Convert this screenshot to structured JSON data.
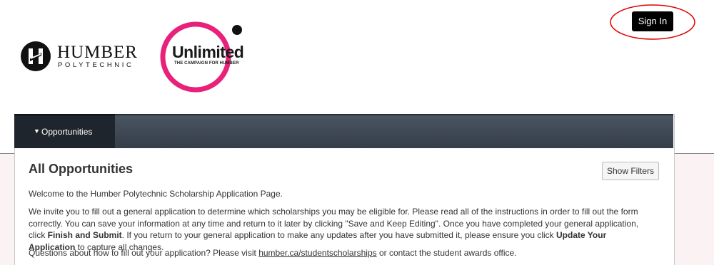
{
  "header": {
    "humber_logo": {
      "name": "HUMBER",
      "subtitle": "POLYTECHNIC"
    },
    "campaign_logo": {
      "name": "Unlimited",
      "subtitle": "THE CAMPAIGN FOR HUMBER",
      "ring_color": "#e8217a"
    },
    "sign_in_label": "Sign In",
    "highlight_color": "#e00000"
  },
  "nav": {
    "active_tab": "Opportunities",
    "caret_icon": "triangle-down-icon"
  },
  "main": {
    "title": "All Opportunities",
    "show_filters_label": "Show Filters",
    "welcome": "Welcome to the Humber Polytechnic Scholarship Application Page.",
    "intro_part1": "We invite you to fill out a general application to determine which scholarships you may be eligible for. Please read all of the instructions in order to fill out the form correctly. You can save your information at any time and return to it later by clicking \"Save and Keep Editing\". Once you have completed your general application, click ",
    "intro_bold1": "Finish and Submit",
    "intro_part2": ". If you return to your general application to make any updates after you have submitted it, please ensure you click ",
    "intro_bold2": "Update Your Application",
    "intro_part3": " to capture all changes.",
    "questions_prefix": "Questions about how to fill out your application? Please visit ",
    "questions_link": "humber.ca/studentscholarships",
    "questions_suffix": " or contact the student awards office."
  }
}
